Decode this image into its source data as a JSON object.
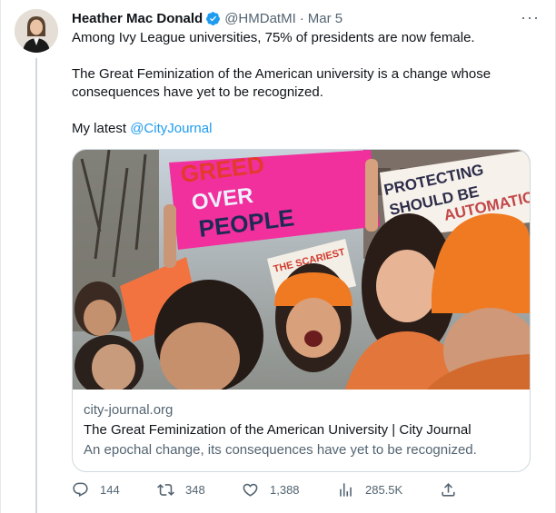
{
  "author": {
    "name": "Heather Mac Donald",
    "handle": "@HMDatMI",
    "separator": "·",
    "date": "Mar 5"
  },
  "tweet": {
    "line1": "Among Ivy League universities, 75% of presidents are now female.",
    "line2": "The Great Feminization of the American university is a change whose consequences have yet to be recognized.",
    "line3_prefix": "My latest ",
    "mention": "@CityJournal"
  },
  "card": {
    "image_signs": {
      "sign1_line1": "GREED",
      "sign1_line2": "OVER",
      "sign1_line3": "PEOPLE",
      "sign2_line1": "PROTECTING",
      "sign2_line2": "SHOULD BE",
      "sign2_line3": "AUTOMATIC",
      "sign3": "THE SCARIEST"
    },
    "domain": "city-journal.org",
    "title": "The Great Feminization of the American University | City Journal",
    "description": "An epochal change, its consequences have yet to be recognized."
  },
  "actions": {
    "replies": "144",
    "reposts": "348",
    "likes": "1,388",
    "views": "285.5K"
  },
  "more_glyph": "···",
  "colors": {
    "accent": "#1d9bf0",
    "text": "#0f1419",
    "secondary": "#536471",
    "border": "#cfd9de",
    "sign_pink": "#f0249c",
    "hat_orange": "#f07a22"
  }
}
